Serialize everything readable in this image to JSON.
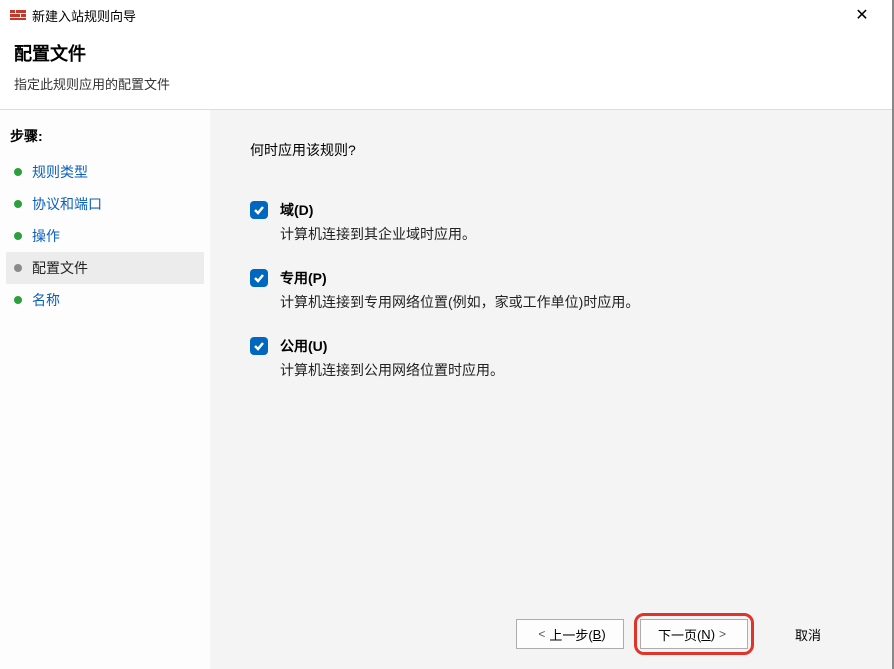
{
  "titlebar": {
    "title": "新建入站规则向导",
    "close": "✕"
  },
  "header": {
    "title": "配置文件",
    "subtitle": "指定此规则应用的配置文件"
  },
  "sidebar": {
    "steps_label": "步骤:",
    "items": [
      {
        "label": "规则类型"
      },
      {
        "label": "协议和端口"
      },
      {
        "label": "操作"
      },
      {
        "label": "配置文件"
      },
      {
        "label": "名称"
      }
    ]
  },
  "content": {
    "question": "何时应用该规则?",
    "options": [
      {
        "title": "域(D)",
        "desc": "计算机连接到其企业域时应用。",
        "checked": true
      },
      {
        "title": "专用(P)",
        "desc": "计算机连接到专用网络位置(例如，家或工作单位)时应用。",
        "checked": true
      },
      {
        "title": "公用(U)",
        "desc": "计算机连接到公用网络位置时应用。",
        "checked": true
      }
    ]
  },
  "footer": {
    "back_prefix": "上一步(",
    "back_key": "B",
    "back_suffix": ")",
    "next_prefix": "下一页(",
    "next_key": "N",
    "next_suffix": ")",
    "cancel": "取消"
  }
}
